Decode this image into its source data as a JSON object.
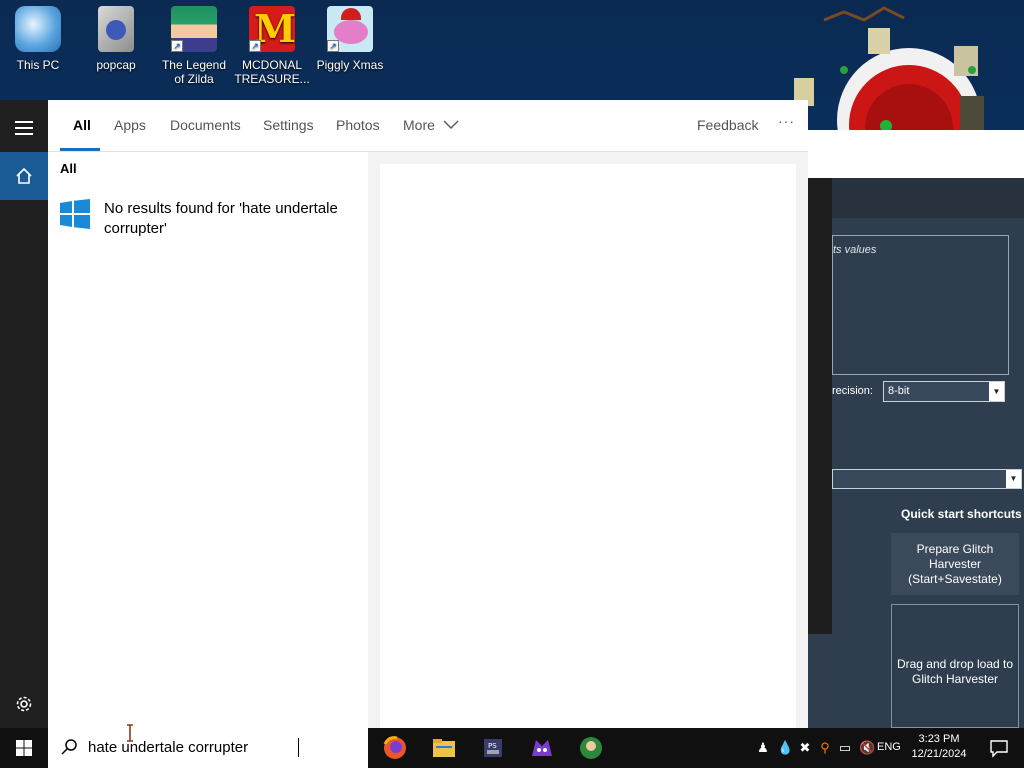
{
  "desktop": {
    "icons": [
      {
        "label": "This PC"
      },
      {
        "label": "popcap"
      },
      {
        "label": "The Legend of Zilda"
      },
      {
        "label": "MCDONAL TREASURE..."
      },
      {
        "label": "Piggly Xmas"
      }
    ]
  },
  "background_app": {
    "values_label": "ts values",
    "precision_label": "recision:",
    "precision_value": "8-bit",
    "quick_start_title": "Quick start shortcuts",
    "prepare_button": "Prepare Glitch Harvester (Start+Savestate)",
    "drop_button": "Drag and drop load to Glitch Harvester"
  },
  "start_menu": {
    "tabs": [
      "All",
      "Apps",
      "Documents",
      "Settings",
      "Photos",
      "More"
    ],
    "feedback": "Feedback",
    "more_options": "···",
    "results_header": "All",
    "no_results": "No results found for 'hate undertale corrupter'"
  },
  "taskbar": {
    "search_query": "hate undertale corrupter",
    "language": "ENG",
    "time": "3:23 PM",
    "date": "12/21/2024"
  },
  "colors": {
    "accent": "#1a6fc0",
    "rail": "#1f1f1f",
    "taskbar": "#101010"
  }
}
